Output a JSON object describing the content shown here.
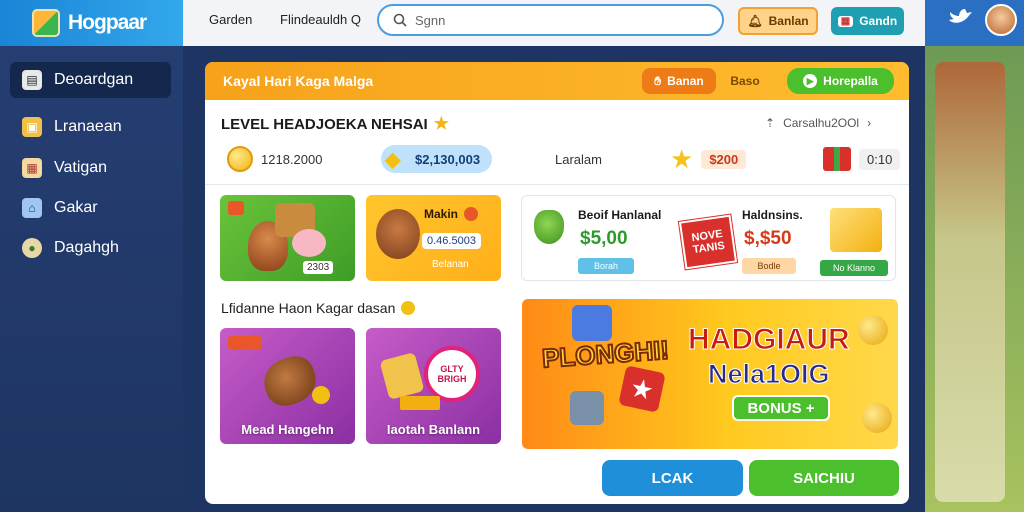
{
  "app": {
    "name": "Hogpaar"
  },
  "sidebar": {
    "items": [
      {
        "label": "Deoardgan",
        "icon": "inbox-icon"
      },
      {
        "label": "Lranaean",
        "icon": "gift-icon"
      },
      {
        "label": "Vatigan",
        "icon": "shop-icon"
      },
      {
        "label": "Gakar",
        "icon": "home-icon"
      },
      {
        "label": "Dagahgh",
        "icon": "user-icon"
      }
    ]
  },
  "topbar": {
    "nav1": "Garden",
    "nav2": "Flindeauldh Q",
    "search_placeholder": "Sgnn",
    "btn1_label": "Banlan",
    "btn2_label": "Gandn"
  },
  "banner": {
    "title": "Kayal Hari Kaga Malga",
    "pill1": "Banan",
    "pill2": "Baso",
    "pill3": "Horepalla"
  },
  "level": {
    "title": "LEVEL HEADJOEKA NEHSAI",
    "right_label": "Carsalhu2OOl",
    "coins": "1218.2000",
    "gems": "$2,130,003",
    "lab_label": "Laralam",
    "stars": "$200",
    "gifts": "0:10"
  },
  "cards": {
    "c1_badge": "2303",
    "c2_title": "Makin",
    "c2_price": "0.46.5003",
    "c2_btn": "Belanan",
    "c3_title": "Beoif Hanlanal",
    "c3_price": "$5,00",
    "c3_btn": "Borah",
    "c3_stamp": "NOVE TANIS",
    "c4_title": "Haldnsins.",
    "c4_price": "$,$50",
    "c4_btn": "Bodle",
    "c4_btn2": "No Klanno"
  },
  "section": {
    "title": "Lfidanne Haon Kagar dasan",
    "card1_label": "Mead Hangehn",
    "card2_label": "Iaotah Banlann",
    "card2_badge": "GLTY BRIGH"
  },
  "promo": {
    "word1": "PLONGHI!",
    "headline1": "HADGIAUR",
    "headline2": "Nela1OIG",
    "bonus": "BONUS +"
  },
  "buttons": {
    "left": "LCAK",
    "right": "SAICHIU"
  },
  "colors": {
    "accent_orange": "#f6a21a",
    "accent_blue": "#1e8fd8",
    "accent_green": "#4cbf2c"
  }
}
